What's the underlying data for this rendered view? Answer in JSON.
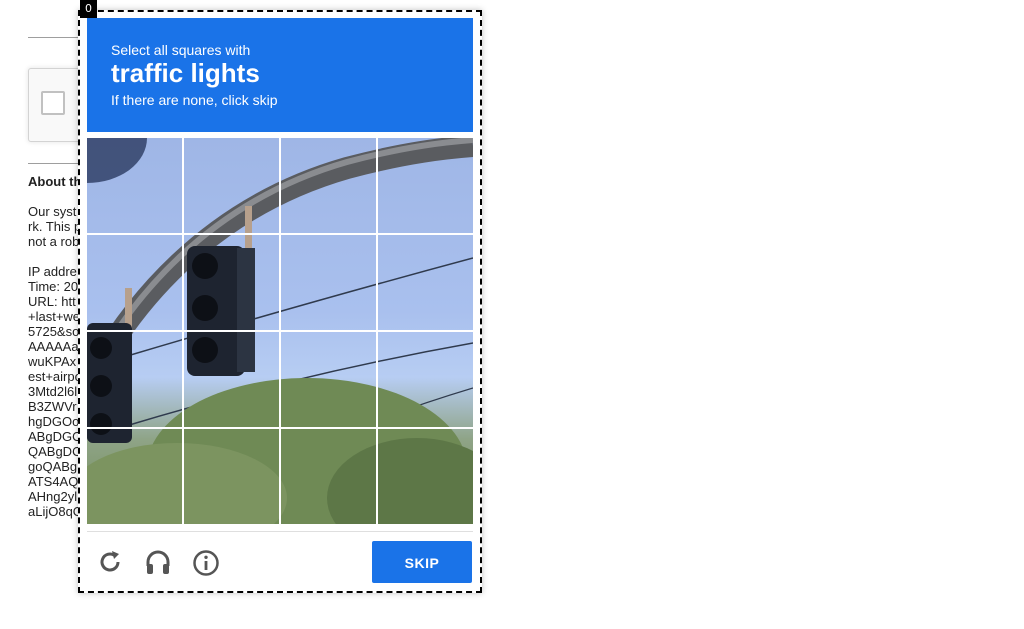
{
  "background_page": {
    "about_heading": "About th",
    "paragraph_lines": [
      "Our syst",
      "rk. This p",
      "not a rob"
    ],
    "detail_lines": [
      "IP addre",
      "Time: 20",
      "URL: htt",
      "+last+we",
      "5725&so",
      "AAAAAa",
      "wuKPAx",
      "est+airpo",
      "3Mtd2l6l",
      "B3ZWVr",
      "hgDGOo",
      "ABgDGO",
      "QABgDO",
      "goQABg",
      "ATS4AQ",
      "AHng2yl",
      "aLijO8qO"
    ]
  },
  "challenge": {
    "frame_label": "0",
    "instruction_prefix": "Select all squares with",
    "target_object": "traffic lights",
    "instruction_hint": "If there are none, click skip",
    "grid_rows": 4,
    "grid_cols": 4,
    "skip_label": "SKIP",
    "icons": [
      "reload-icon",
      "audio-headphones-icon",
      "info-icon"
    ],
    "colors": {
      "accent": "#1a73e8",
      "sky": "#a9c0ee",
      "trees": "#6f8a55"
    }
  }
}
